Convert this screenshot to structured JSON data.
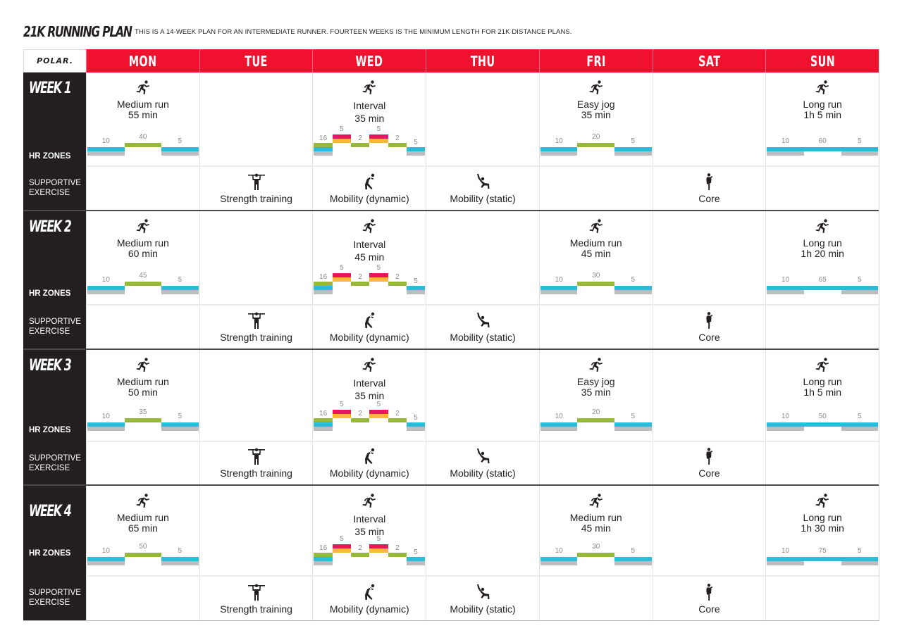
{
  "title": "21K RUNNING PLAN",
  "subtitle": "THIS IS A 14-WEEK PLAN FOR AN INTERMEDIATE RUNNER. FOURTEEN WEEKS IS THE MINIMUM LENGTH FOR 21K DISTANCE PLANS.",
  "brand": "POLAR.",
  "colors": {
    "header_red": "#f0112f",
    "sidebar_dark": "#231f20",
    "zone1_gray": "#bcbdc0",
    "zone2_blue": "#2bbcda",
    "zone3_green": "#96b93a",
    "zone4_yellow": "#f8b833",
    "zone5_red": "#e4185a"
  },
  "days": [
    "MON",
    "TUE",
    "WED",
    "THU",
    "FRI",
    "SAT",
    "SUN"
  ],
  "labels": {
    "hr_zones": "HR ZONES",
    "supportive_1": "SUPPORTIVE",
    "supportive_2": "EXERCISE"
  },
  "icons": {
    "run": "runner-icon",
    "strength": "strength-training-icon",
    "mobility_dynamic": "mobility-dynamic-icon",
    "mobility_static": "mobility-static-icon",
    "core": "core-icon"
  },
  "weeks": [
    {
      "label": "WEEK 1",
      "sessions": {
        "MON": {
          "name": "Medium run",
          "duration": "55 min",
          "type": "steady",
          "zones": [
            10,
            40,
            5
          ]
        },
        "WED": {
          "name": "Interval",
          "duration": "35 min",
          "type": "interval",
          "zones": [
            16,
            5,
            2,
            5,
            2,
            5
          ]
        },
        "FRI": {
          "name": "Easy jog",
          "duration": "35 min",
          "type": "steady",
          "zones": [
            10,
            20,
            5
          ]
        },
        "SUN": {
          "name": "Long run",
          "duration": "1h 5 min",
          "type": "long",
          "zones": [
            10,
            60,
            5
          ]
        }
      },
      "supportive": {
        "TUE": {
          "name": "Strength training",
          "icon": "strength"
        },
        "WED": {
          "name": "Mobility (dynamic)",
          "icon": "mobility_dynamic"
        },
        "THU": {
          "name": "Mobility (static)",
          "icon": "mobility_static"
        },
        "SAT": {
          "name": "Core",
          "icon": "core"
        }
      }
    },
    {
      "label": "WEEK 2",
      "sessions": {
        "MON": {
          "name": "Medium run",
          "duration": "60 min",
          "type": "steady",
          "zones": [
            10,
            45,
            5
          ]
        },
        "WED": {
          "name": "Interval",
          "duration": "45 min",
          "type": "interval",
          "zones": [
            16,
            5,
            2,
            5,
            2,
            5
          ]
        },
        "FRI": {
          "name": "Medium run",
          "duration": "45 min",
          "type": "steady",
          "zones": [
            10,
            30,
            5
          ]
        },
        "SUN": {
          "name": "Long run",
          "duration": "1h 20 min",
          "type": "long",
          "zones": [
            10,
            65,
            5
          ]
        }
      },
      "supportive": {
        "TUE": {
          "name": "Strength training",
          "icon": "strength"
        },
        "WED": {
          "name": "Mobility (dynamic)",
          "icon": "mobility_dynamic"
        },
        "THU": {
          "name": "Mobility (static)",
          "icon": "mobility_static"
        },
        "SAT": {
          "name": "Core",
          "icon": "core"
        }
      }
    },
    {
      "label": "WEEK 3",
      "sessions": {
        "MON": {
          "name": "Medium run",
          "duration": "50 min",
          "type": "steady",
          "zones": [
            10,
            35,
            5
          ]
        },
        "WED": {
          "name": "Interval",
          "duration": "35 min",
          "type": "interval",
          "zones": [
            16,
            5,
            2,
            5,
            2,
            5
          ]
        },
        "FRI": {
          "name": "Easy jog",
          "duration": "35 min",
          "type": "steady",
          "zones": [
            10,
            20,
            5
          ]
        },
        "SUN": {
          "name": "Long run",
          "duration": "1h 5 min",
          "type": "long",
          "zones": [
            10,
            50,
            5
          ]
        }
      },
      "supportive": {
        "TUE": {
          "name": "Strength training",
          "icon": "strength"
        },
        "WED": {
          "name": "Mobility (dynamic)",
          "icon": "mobility_dynamic"
        },
        "THU": {
          "name": "Mobility (static)",
          "icon": "mobility_static"
        },
        "SAT": {
          "name": "Core",
          "icon": "core"
        }
      }
    },
    {
      "label": "WEEK 4",
      "sessions": {
        "MON": {
          "name": "Medium run",
          "duration": "65 min",
          "type": "steady",
          "zones": [
            10,
            50,
            5
          ]
        },
        "WED": {
          "name": "Interval",
          "duration": "35 min",
          "type": "interval",
          "zones": [
            16,
            5,
            2,
            5,
            2,
            5
          ]
        },
        "FRI": {
          "name": "Medium run",
          "duration": "45 min",
          "type": "steady",
          "zones": [
            10,
            30,
            5
          ]
        },
        "SUN": {
          "name": "Long run",
          "duration": "1h 30 min",
          "type": "long",
          "zones": [
            10,
            75,
            5
          ]
        }
      },
      "supportive": {
        "TUE": {
          "name": "Strength training",
          "icon": "strength"
        },
        "WED": {
          "name": "Mobility (dynamic)",
          "icon": "mobility_dynamic"
        },
        "THU": {
          "name": "Mobility (static)",
          "icon": "mobility_static"
        },
        "SAT": {
          "name": "Core",
          "icon": "core"
        }
      }
    }
  ]
}
